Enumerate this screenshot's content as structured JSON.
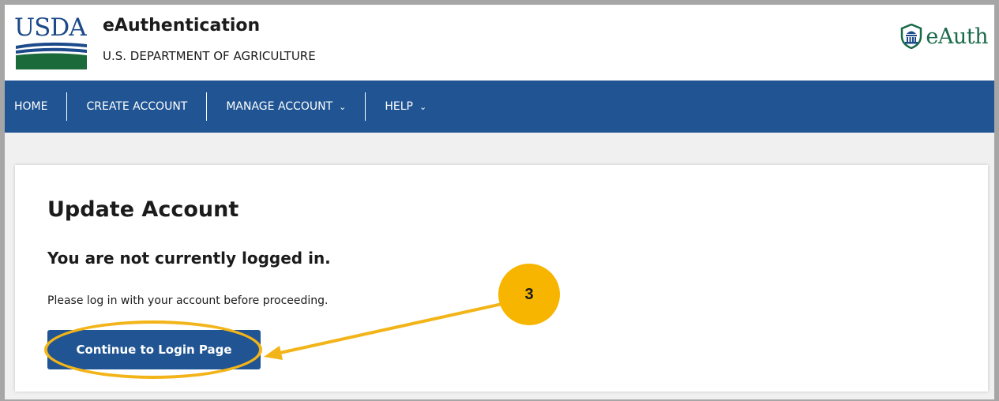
{
  "header": {
    "logo_text": "USDA",
    "site_name": "eAuthentication",
    "agency_name": "U.S. DEPARTMENT OF AGRICULTURE",
    "right_logo_text": "eAuth"
  },
  "nav": {
    "items": [
      {
        "label": "HOME",
        "has_dropdown": false
      },
      {
        "label": "CREATE ACCOUNT",
        "has_dropdown": false
      },
      {
        "label": "MANAGE ACCOUNT",
        "has_dropdown": true
      },
      {
        "label": "HELP",
        "has_dropdown": true
      }
    ]
  },
  "main": {
    "title": "Update Account",
    "subtitle": "You are not currently logged in.",
    "description": "Please log in with your account before proceeding.",
    "login_button": "Continue to Login Page"
  },
  "annotation": {
    "step": "3"
  },
  "colors": {
    "brand_blue": "#205493",
    "usda_green": "#1a6a4a",
    "annotation_yellow": "#f7b500"
  }
}
